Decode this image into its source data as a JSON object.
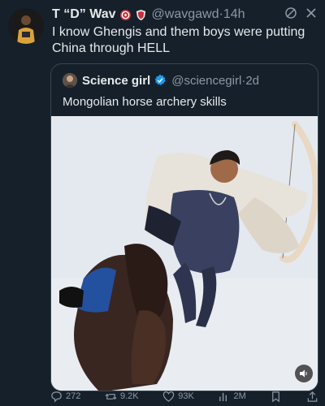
{
  "tweet": {
    "author_name": "T “D” Wav",
    "author_handle": "@wavgawd",
    "time": "14h",
    "separator": "·",
    "text": "I know Ghengis and them boys were putting China through HELL"
  },
  "quoted": {
    "author_name": "Science girl",
    "author_handle": "@sciencegirl",
    "time": "2d",
    "separator": "·",
    "text": "Mongolian horse archery skills"
  },
  "actions": {
    "replies": "272",
    "retweets": "9.2K",
    "likes": "93K",
    "views": "2M"
  },
  "colors": {
    "background": "#15202b",
    "secondary_text": "#8b98a5",
    "verified_blue": "#1d9bf0",
    "border": "#38444d"
  },
  "icons": {
    "header": [
      "mute-icon",
      "close-icon"
    ],
    "badges": [
      "badge-emblem-icon",
      "shield-badge-icon"
    ],
    "actions": [
      "reply-icon",
      "retweet-icon",
      "like-icon",
      "views-icon",
      "bookmark-icon",
      "share-icon"
    ],
    "media": [
      "sound-icon"
    ]
  }
}
